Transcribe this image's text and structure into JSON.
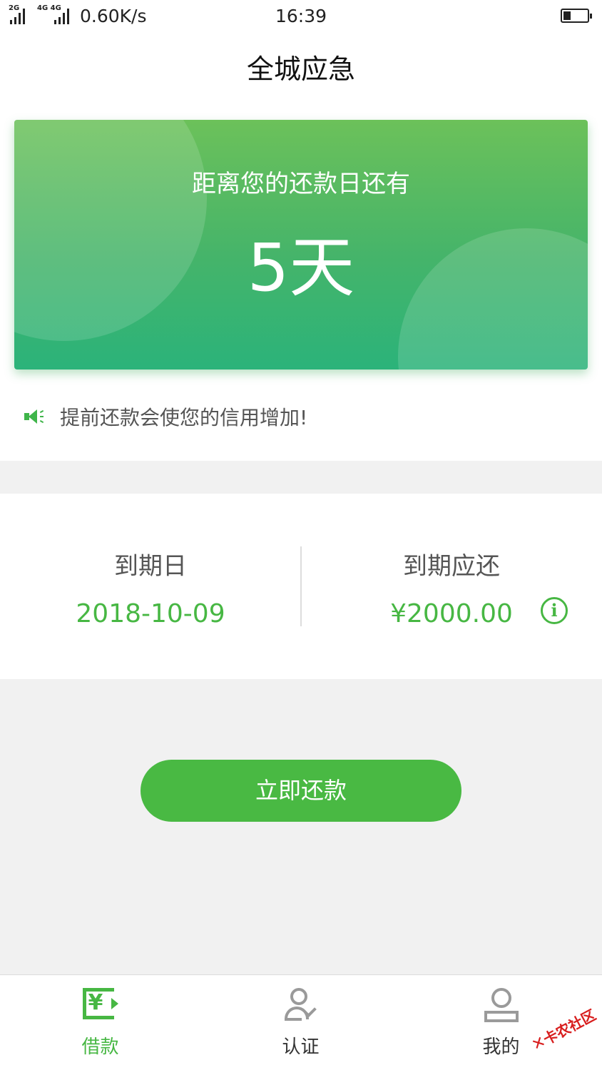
{
  "status_bar": {
    "signal_1_tag": "2G",
    "signal_2_tag": "4G 4G",
    "network_speed": "0.60K/s",
    "time": "16:39"
  },
  "header": {
    "title": "全城应急"
  },
  "countdown_card": {
    "subtitle": "距离您的还款日还有",
    "days": "5天"
  },
  "notice": {
    "text": "提前还款会使您的信用增加!"
  },
  "due_info": {
    "due_date_label": "到期日",
    "due_date_value": "2018-10-09",
    "due_amount_label": "到期应还",
    "due_amount_value": "¥2000.00"
  },
  "repay_button": {
    "label": "立即还款"
  },
  "tab_bar": {
    "tabs": [
      {
        "label": "借款",
        "icon": "loan-icon",
        "active": true
      },
      {
        "label": "认证",
        "icon": "certify-icon",
        "active": false
      },
      {
        "label": "我的",
        "icon": "profile-icon",
        "active": false
      }
    ]
  },
  "watermark": {
    "text": "卡农社区"
  },
  "colors": {
    "accent": "#47b743",
    "card_gradient_top": "#6cc15a",
    "card_gradient_bottom": "#2bb37a",
    "background": "#f1f1f1"
  }
}
